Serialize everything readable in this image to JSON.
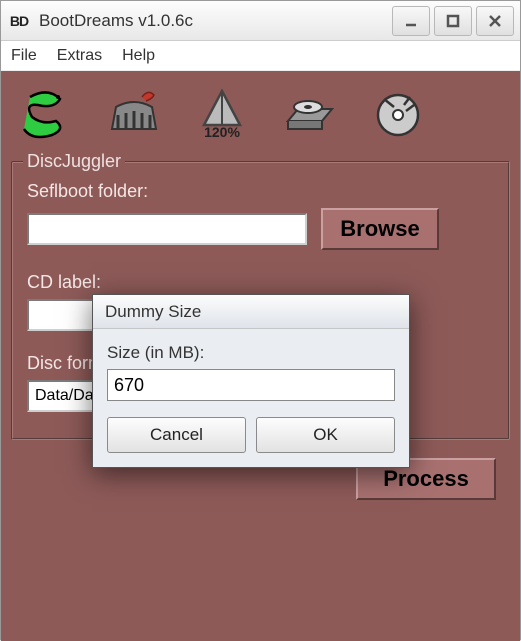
{
  "window": {
    "app_icon_text": "BD",
    "title": "BootDreams v1.0.6c"
  },
  "menu": {
    "file": "File",
    "extras": "Extras",
    "help": "Help"
  },
  "toolbar": {
    "snake": "snake-icon",
    "colosseum": "colosseum-icon",
    "a120": "120%",
    "drive": "disc-drive-icon",
    "disc": "disc-icon"
  },
  "group": {
    "legend": "DiscJuggler",
    "selfboot_label": "Seflboot folder:",
    "selfboot_value": "",
    "browse": "Browse",
    "cdlabel_label": "CD label:",
    "cdlabel_value": "",
    "discformat_label": "Disc format:",
    "discformat_value": "Data/Data"
  },
  "process": "Process",
  "dialog": {
    "title": "Dummy Size",
    "size_label": "Size (in MB):",
    "size_value": "670",
    "cancel": "Cancel",
    "ok": "OK"
  }
}
